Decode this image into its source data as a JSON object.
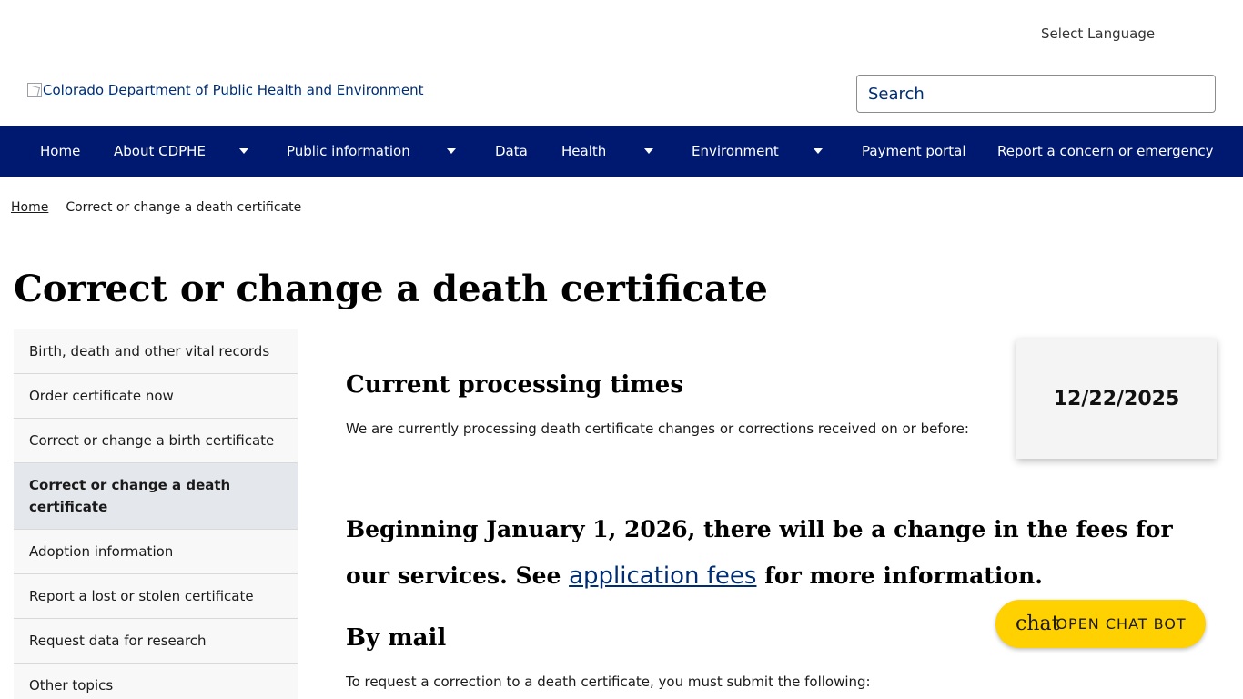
{
  "header": {
    "language_label": "Select Language",
    "logo_alt": "Colorado Department of Public Health and Environment",
    "search_placeholder": "Search"
  },
  "nav": {
    "items": [
      {
        "label": "Home",
        "has_dropdown": false
      },
      {
        "label": "About CDPHE",
        "has_dropdown": true
      },
      {
        "label": "Public information",
        "has_dropdown": true
      },
      {
        "label": "Data",
        "has_dropdown": false
      },
      {
        "label": "Health",
        "has_dropdown": true
      },
      {
        "label": "Environment",
        "has_dropdown": true
      },
      {
        "label": "Payment portal",
        "has_dropdown": false
      },
      {
        "label": "Report a concern or emergency",
        "has_dropdown": false
      }
    ]
  },
  "breadcrumb": {
    "home": "Home",
    "current": "Correct or change a death certificate"
  },
  "page": {
    "title": "Correct or change a death certificate"
  },
  "sidebar": {
    "items": [
      {
        "label": "Birth, death and other vital records",
        "active": false
      },
      {
        "label": "Order certificate now",
        "active": false
      },
      {
        "label": "Correct or change a birth certificate",
        "active": false
      },
      {
        "label": "Correct or change a death certificate",
        "active": true
      },
      {
        "label": "Adoption information",
        "active": false
      },
      {
        "label": "Report a lost or stolen certificate",
        "active": false
      },
      {
        "label": "Request data for research",
        "active": false
      },
      {
        "label": "Other topics",
        "active": false
      }
    ]
  },
  "content": {
    "processing_heading": "Current processing times",
    "processing_text": "We are currently processing death certificate changes or corrections received on or before:",
    "processing_date": "12/22/2025",
    "fees_text_before": "Beginning January 1, 2026, there will be a change in the fees for our services. See ",
    "fees_link": "application fees",
    "fees_text_after": " for more information.",
    "mail_heading": "By mail",
    "mail_text": "To request a correction to a death certificate, you must submit the following:"
  },
  "chat": {
    "glyph": "chat",
    "label": "OPEN CHAT BOT"
  },
  "colors": {
    "nav_bg": "#001970",
    "link": "#002d72",
    "chat_button": "#ffd100",
    "sidebar_active": "#e4e7ec"
  }
}
